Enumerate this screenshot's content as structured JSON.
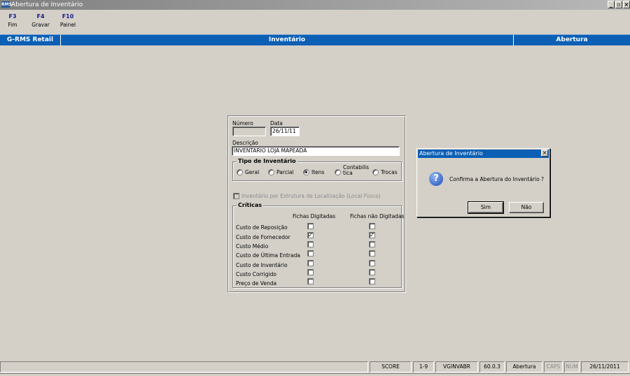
{
  "window": {
    "title": "Abertura de Inventário",
    "app_icon": "RMS"
  },
  "function_keys": [
    {
      "key": "F3",
      "label": "Fim"
    },
    {
      "key": "F4",
      "label": "Gravar"
    },
    {
      "key": "F10",
      "label": "Painel"
    }
  ],
  "header": {
    "left": "G-RMS Retail",
    "center": "Inventário",
    "right": "Abertura"
  },
  "form": {
    "numero_label": "Número",
    "numero_value": "",
    "data_label": "Data",
    "data_value": "26/11/11",
    "descricao_label": "Descrição",
    "descricao_value": "INVENTARIO LOJA MAPEADA",
    "tipo": {
      "title": "Tipo de Inventário",
      "options": [
        "Geral",
        "Parcial",
        "Itens",
        "Contabilis tica",
        "Trocas"
      ],
      "selected": "Itens"
    },
    "estrutura_label": "Inventário por Estrutura de Localização (Local Físico)",
    "criticas": {
      "title": "Críticas",
      "col1": "Fichas Digitadas",
      "col2": "Fichas não Digitadas",
      "rows": [
        {
          "label": "Custo de Reposição",
          "digitadas": false,
          "nao_digitadas": false
        },
        {
          "label": "Custo de Fornecedor",
          "digitadas": true,
          "nao_digitadas": true
        },
        {
          "label": "Custo Médio",
          "digitadas": false,
          "nao_digitadas": false
        },
        {
          "label": "Custo de Última Entrada",
          "digitadas": false,
          "nao_digitadas": false
        },
        {
          "label": "Custo de Inventário",
          "digitadas": false,
          "nao_digitadas": false
        },
        {
          "label": "Custo Corrigido",
          "digitadas": false,
          "nao_digitadas": false
        },
        {
          "label": "Preço de Venda",
          "digitadas": false,
          "nao_digitadas": false
        }
      ]
    }
  },
  "dialog": {
    "title": "Abertura de Inventário",
    "message": "Confirma a Abertura do Inventário ?",
    "yes": "Sim",
    "no": "Não",
    "icon": "question-icon"
  },
  "statusbar": {
    "score": "SCORE",
    "range": "1-9",
    "program": "VGINVABR",
    "version": "60.0.3",
    "mode": "Abertura",
    "caps": "CAPS",
    "num": "NUM",
    "date": "26/11/2011"
  },
  "colors": {
    "header_blue": "#0b5fb5",
    "fkey_text": "#1a1a8c",
    "face": "#d4d0c8"
  }
}
